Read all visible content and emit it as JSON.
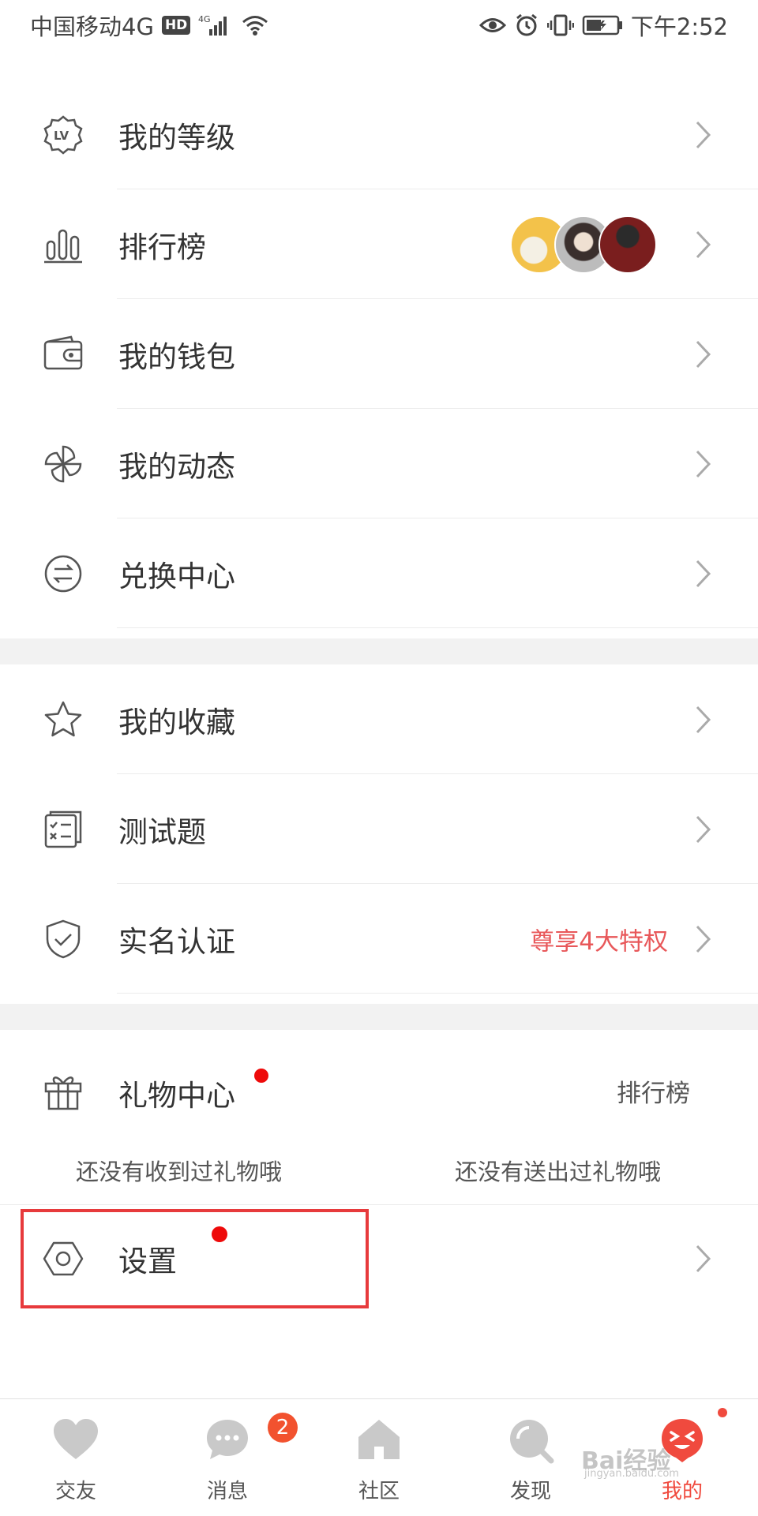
{
  "status_bar": {
    "carrier": "中国移动4G",
    "hd": "HD",
    "net": "4G",
    "time": "下午2:52"
  },
  "menu_group1": [
    {
      "label": "我的等级",
      "icon": "level-icon"
    },
    {
      "label": "排行榜",
      "icon": "ranking-icon"
    },
    {
      "label": "我的钱包",
      "icon": "wallet-icon"
    },
    {
      "label": "我的动态",
      "icon": "pinwheel-icon"
    },
    {
      "label": "兑换中心",
      "icon": "exchange-icon"
    }
  ],
  "menu_group2": [
    {
      "label": "我的收藏",
      "icon": "star-icon"
    },
    {
      "label": "测试题",
      "icon": "quiz-icon"
    },
    {
      "label": "实名认证",
      "icon": "shield-check-icon",
      "extra": "尊享4大特权"
    }
  ],
  "gift": {
    "title": "礼物中心",
    "ranking_link": "排行榜",
    "received": "还没有收到过礼物哦",
    "sent": "还没有送出过礼物哦"
  },
  "settings": {
    "label": "设置",
    "icon": "settings-icon"
  },
  "tabbar": {
    "tabs": [
      {
        "label": "交友",
        "icon": "heart-icon"
      },
      {
        "label": "消息",
        "icon": "chat-icon"
      },
      {
        "label": "社区",
        "icon": "home-icon"
      },
      {
        "label": "发现",
        "icon": "discover-icon"
      },
      {
        "label": "我的",
        "icon": "me-icon"
      }
    ],
    "message_badge": "2",
    "active_index": 4
  },
  "watermark": {
    "main": "Bai经验",
    "sub": "jingyan.baidu.com"
  },
  "colors": {
    "accent": "#f04a3e",
    "promo_text": "#e8585a",
    "highlight_border": "#e73a3c",
    "dot": "#ee0a0a",
    "section_gap": "#f2f2f2"
  }
}
